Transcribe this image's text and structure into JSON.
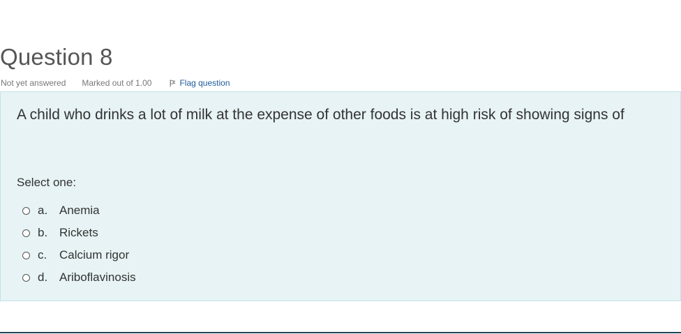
{
  "question": {
    "title": "Question 8",
    "state": "Not yet answered",
    "grade": "Marked out of 1.00",
    "flag_label": "Flag question",
    "text": "A child who drinks a lot of milk at the expense of other foods is at high risk of showing signs of",
    "prompt": "Select one:",
    "options": [
      {
        "letter": "a.",
        "text": "Anemia"
      },
      {
        "letter": "b.",
        "text": "Rickets"
      },
      {
        "letter": "c.",
        "text": "Calcium rigor"
      },
      {
        "letter": "d.",
        "text": "Ariboflavinosis"
      }
    ]
  },
  "icons": {
    "flag": "flag-icon",
    "radio": "radio-unchecked-icon"
  },
  "colors": {
    "panel_background": "#e7f3f5",
    "panel_border": "#c3e3ea",
    "link": "#1d5b9e",
    "bottom_rule": "#1e4354"
  }
}
